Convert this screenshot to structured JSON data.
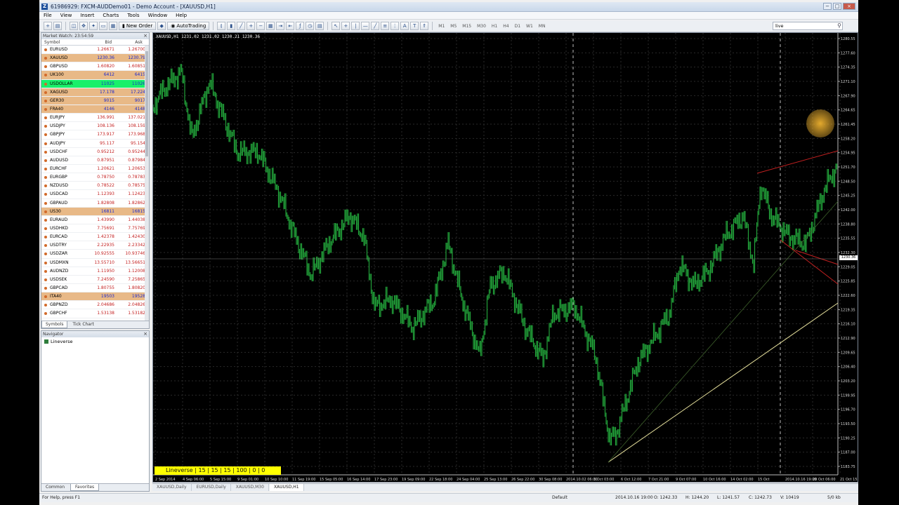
{
  "window": {
    "title": "61986929: FXCM-AUDDemo01 - Demo Account - [XAUUSD,H1]",
    "controls": [
      "−",
      "□",
      "×"
    ]
  },
  "menu": [
    "File",
    "View",
    "Insert",
    "Charts",
    "Tools",
    "Window",
    "Help"
  ],
  "toolbar": {
    "new_order": "New Order",
    "autotrading": "AutoTrading",
    "periods": [
      "M1",
      "M5",
      "M15",
      "M30",
      "H1",
      "H4",
      "D1",
      "W1",
      "MN"
    ],
    "search_value": "live"
  },
  "market_watch": {
    "title": "Market Watch: 23:54:59",
    "headers": {
      "symbol": "Symbol",
      "bid": "Bid",
      "ask": "Ask"
    },
    "rows": [
      {
        "symbol": "EURUSD",
        "bid": "1.26671",
        "ask": "1.26700",
        "hl": ""
      },
      {
        "symbol": "XAUUSD",
        "bid": "1230.36",
        "ask": "1230.79",
        "hl": "orange"
      },
      {
        "symbol": "GBPUSD",
        "bid": "1.60820",
        "ask": "1.60851",
        "hl": ""
      },
      {
        "symbol": "UK100",
        "bid": "6412",
        "ask": "6415",
        "hl": "orange"
      },
      {
        "symbol": "USDOLLAR",
        "bid": "11025",
        "ask": "11026",
        "hl": "green"
      },
      {
        "symbol": "XAGUSD",
        "bid": "17.178",
        "ask": "17.224",
        "hl": "orange"
      },
      {
        "symbol": "GER30",
        "bid": "9015",
        "ask": "9017",
        "hl": "orange"
      },
      {
        "symbol": "FRA40",
        "bid": "4146",
        "ask": "4148",
        "hl": "orange"
      },
      {
        "symbol": "EURJPY",
        "bid": "136.991",
        "ask": "137.021",
        "hl": ""
      },
      {
        "symbol": "USDJPY",
        "bid": "108.136",
        "ask": "108.159",
        "hl": ""
      },
      {
        "symbol": "GBPJPY",
        "bid": "173.917",
        "ask": "173.968",
        "hl": ""
      },
      {
        "symbol": "AUDJPY",
        "bid": "95.117",
        "ask": "95.154",
        "hl": ""
      },
      {
        "symbol": "USDCHF",
        "bid": "0.95212",
        "ask": "0.95244",
        "hl": ""
      },
      {
        "symbol": "AUDUSD",
        "bid": "0.87951",
        "ask": "0.87984",
        "hl": ""
      },
      {
        "symbol": "EURCHF",
        "bid": "1.20621",
        "ask": "1.20653",
        "hl": ""
      },
      {
        "symbol": "EURGBP",
        "bid": "0.78750",
        "ask": "0.78783",
        "hl": ""
      },
      {
        "symbol": "NZDUSD",
        "bid": "0.78522",
        "ask": "0.78575",
        "hl": ""
      },
      {
        "symbol": "USDCAD",
        "bid": "1.12393",
        "ask": "1.12423",
        "hl": ""
      },
      {
        "symbol": "GBPAUD",
        "bid": "1.82808",
        "ask": "1.82862",
        "hl": ""
      },
      {
        "symbol": "US30",
        "bid": "16811",
        "ask": "16815",
        "hl": "orange"
      },
      {
        "symbol": "EURAUD",
        "bid": "1.43990",
        "ask": "1.44038",
        "hl": ""
      },
      {
        "symbol": "USDHKD",
        "bid": "7.75691",
        "ask": "7.75769",
        "hl": ""
      },
      {
        "symbol": "EURCAD",
        "bid": "1.42378",
        "ask": "1.42430",
        "hl": ""
      },
      {
        "symbol": "USDTRY",
        "bid": "2.22935",
        "ask": "2.23342",
        "hl": ""
      },
      {
        "symbol": "USDZAR",
        "bid": "10.92555",
        "ask": "10.93746",
        "hl": ""
      },
      {
        "symbol": "USDMXN",
        "bid": "13.55710",
        "ask": "13.56651",
        "hl": ""
      },
      {
        "symbol": "AUDNZD",
        "bid": "1.11950",
        "ask": "1.12008",
        "hl": ""
      },
      {
        "symbol": "USDSEK",
        "bid": "7.24590",
        "ask": "7.25865",
        "hl": ""
      },
      {
        "symbol": "GBPCAD",
        "bid": "1.80755",
        "ask": "1.80820",
        "hl": ""
      },
      {
        "symbol": "ITA40",
        "bid": "19503",
        "ask": "19528",
        "hl": "orange"
      },
      {
        "symbol": "GBPNZD",
        "bid": "2.04686",
        "ask": "2.04826",
        "hl": ""
      },
      {
        "symbol": "GBPCHF",
        "bid": "1.53138",
        "ask": "1.53182",
        "hl": ""
      }
    ],
    "tabs": [
      "Symbols",
      "Tick Chart"
    ]
  },
  "navigator": {
    "title": "Navigator",
    "items": [
      "Lineverse"
    ],
    "tabs": [
      "Common",
      "Favorites"
    ]
  },
  "chart": {
    "header": "XAUUSD,H1  1231.02 1231.02 1230.21 1230.36",
    "overlay": "Lineverse | 15 | 15 | 15 | 100 | 0 | 0",
    "current_price": "1230.36",
    "x_labels": [
      "2 Sep 2014",
      "4 Sep 06:00",
      "5 Sep 15:00",
      "9 Sep 01:00",
      "10 Sep 10:00",
      "11 Sep 19:00",
      "15 Sep 05:00",
      "16 Sep 14:00",
      "17 Sep 23:00",
      "19 Sep 09:00",
      "22 Sep 18:00",
      "24 Sep 04:00",
      "25 Sep 13:00",
      "26 Sep 22:00",
      "30 Sep 08:00",
      "2014.10.02 06:00",
      "3 Oct 03:00",
      "6 Oct 12:00",
      "7 Oct 21:00",
      "9 Oct 07:00",
      "10 Oct 16:00",
      "14 Oct 02:00",
      "15 Oct",
      "2014.10.16 19:00",
      "20 Oct 06:00",
      "21 Oct 15:00"
    ],
    "y_labels": [
      "1280.55",
      "1277.60",
      "1274.35",
      "1271.10",
      "1267.90",
      "1264.65",
      "1261.45",
      "1258.20",
      "1254.95",
      "1251.70",
      "1248.50",
      "1245.25",
      "1242.00",
      "1238.80",
      "1235.55",
      "1232.30",
      "1229.05",
      "1225.85",
      "1222.60",
      "1219.35",
      "1216.10",
      "1212.90",
      "1209.65",
      "1206.40",
      "1203.20",
      "1199.95",
      "1196.70",
      "1193.50",
      "1190.25",
      "1187.00",
      "1183.75"
    ],
    "colors": {
      "candles": "#22a13a",
      "grid": "#2a2a2a",
      "trend_yellow": "#e6e09c",
      "trend_red": "#c02020"
    }
  },
  "chart_tabs": [
    "XAUUSD,Daily",
    "EURUSD,Daily",
    "XAUUSD,M30",
    "XAUUSD,H1"
  ],
  "status": {
    "help": "For Help, press F1",
    "profile": "Default",
    "time": "2014.10.16 19:00",
    "open": "O: 1242.33",
    "high": "H: 1244.20",
    "low": "L: 1241.57",
    "close": "C: 1242.73",
    "volume": "V: 10419",
    "traffic": "5/0 kb"
  }
}
